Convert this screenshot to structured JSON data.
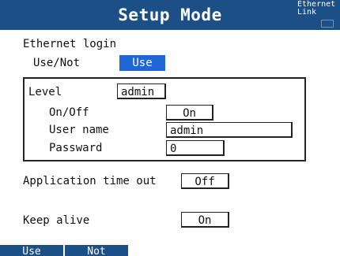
{
  "title": "Setup Mode",
  "status": {
    "line1": "Ethernet",
    "line2": "Link"
  },
  "ethernet_login": {
    "heading": "Ethernet login",
    "use_not_label": "Use/Not",
    "use_not_value": "Use"
  },
  "level_group": {
    "level_label": "Level",
    "level_value": "admin",
    "onoff_label": "On/Off",
    "onoff_value": "On",
    "username_label": "User name",
    "username_value": "admin",
    "password_label": "Passward",
    "password_value": "0"
  },
  "application_timeout": {
    "label": "Application time out",
    "value": "Off"
  },
  "keep_alive": {
    "label": "Keep alive",
    "value": "On"
  },
  "softkeys": [
    "Use",
    "Not"
  ],
  "colors": {
    "titlebar": "#1c4f86",
    "selection": "#1f67d6",
    "softkey": "#1c4f86"
  }
}
